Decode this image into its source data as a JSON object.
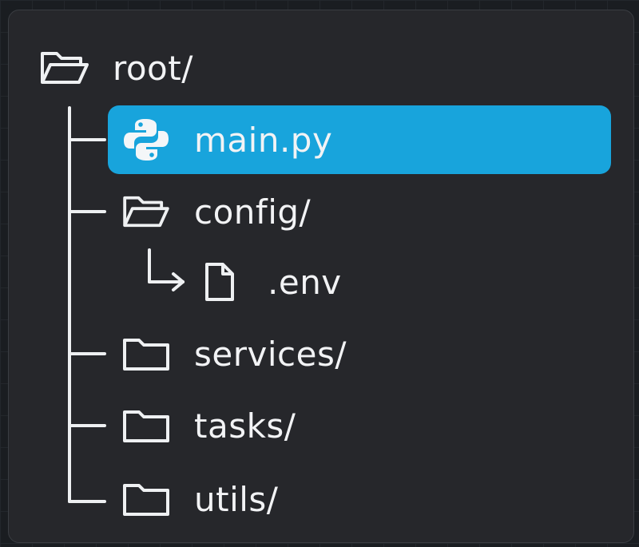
{
  "tree": {
    "root": {
      "label": "root/",
      "icon": "folder-open-icon"
    },
    "items": [
      {
        "label": "main.py",
        "icon": "python-icon",
        "selected": true
      },
      {
        "label": "config/",
        "icon": "folder-open-icon"
      },
      {
        "label": ".env",
        "icon": "file-icon"
      },
      {
        "label": "services/",
        "icon": "folder-icon"
      },
      {
        "label": "tasks/",
        "icon": "folder-icon"
      },
      {
        "label": "utils/",
        "icon": "folder-icon"
      }
    ]
  },
  "colors": {
    "selection": "#18a4dc",
    "panel": "#26272b",
    "text": "#f2f3f5"
  }
}
